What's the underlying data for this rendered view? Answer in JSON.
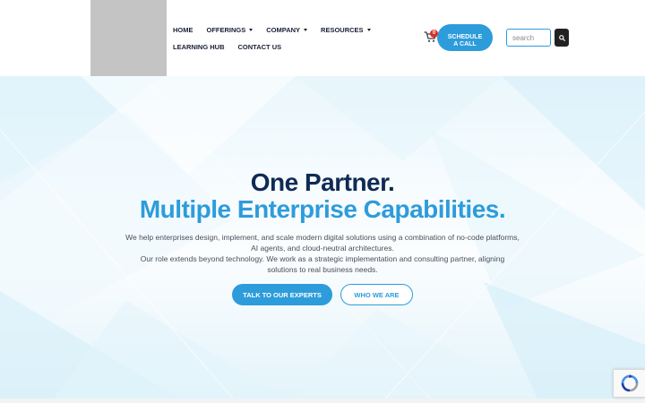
{
  "header": {
    "nav_row1": [
      {
        "label": "HOME",
        "has_caret": false
      },
      {
        "label": "OFFERINGS",
        "has_caret": true
      },
      {
        "label": "COMPANY",
        "has_caret": true
      },
      {
        "label": "RESOURCES",
        "has_caret": true
      }
    ],
    "nav_row2": [
      {
        "label": "LEARNING HUB"
      },
      {
        "label": "CONTACT US"
      }
    ],
    "cart": {
      "icon": "cart-icon",
      "count": "0"
    },
    "schedule": {
      "line1": "SCHEDULE",
      "line2": "A CALL"
    },
    "search": {
      "placeholder": "search",
      "value": "",
      "icon": "search-icon"
    }
  },
  "hero": {
    "headline_line1": "One Partner.",
    "headline_line2": "Multiple Enterprise Capabilities.",
    "description_line1": "We help enterprises design, implement, and scale modern digital solutions using a combination of no-code platforms, AI agents, and cloud-neutral architectures.",
    "description_line2": "Our role extends beyond technology. We work as a strategic implementation and consulting partner, aligning solutions to real business needs.",
    "primary_cta": "TALK TO OUR EXPERTS",
    "secondary_cta": "WHO WE ARE"
  },
  "colors": {
    "accent": "#2d9cdb",
    "headline_dark": "#0f2a55",
    "badge": "#d93025",
    "logo_placeholder": "#c4c4c4"
  },
  "widgets": {
    "recaptcha_icon": "recaptcha-icon"
  }
}
